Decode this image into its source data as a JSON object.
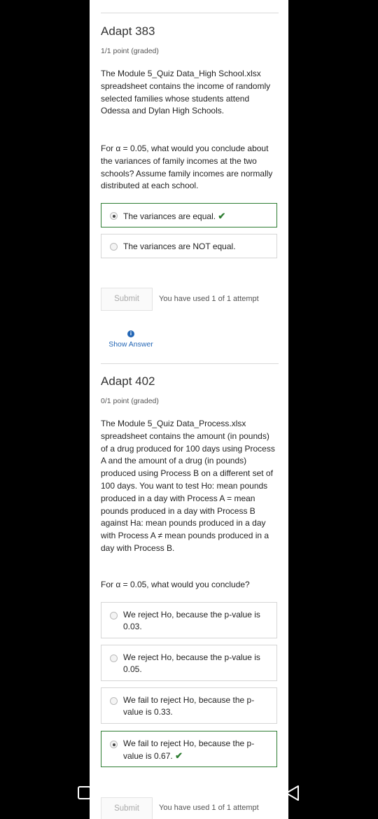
{
  "q1": {
    "title": "Adapt 383",
    "points": "1/1 point (graded)",
    "para1": "The Module 5_Quiz Data_High School.xlsx spreadsheet contains the income of randomly selected families whose students attend Odessa and Dylan High Schools.",
    "para2": "For α = 0.05, what would you conclude about the variances of family incomes at the two schools? Assume family incomes are normally distributed at each school.",
    "choices": [
      {
        "label": "The variances are equal.",
        "selected": true,
        "correct": true
      },
      {
        "label": "The variances are NOT equal.",
        "selected": false,
        "correct": false
      }
    ],
    "submit": "Submit",
    "attempts": "You have used 1 of 1 attempt",
    "show_answer": "Show Answer"
  },
  "q2": {
    "title": "Adapt 402",
    "points": "0/1 point (graded)",
    "para1": "The Module 5_Quiz Data_Process.xlsx spreadsheet contains the amount (in pounds) of a drug produced for 100 days using Process A and the amount of a drug (in pounds) produced using Process B on a different set of 100 days. You want to test Ho: mean pounds produced in a day with Process A = mean pounds produced in a day with Process B against Ha: mean pounds produced in a day with Process A ≠ mean pounds produced in a day with Process B.",
    "para2": "For α = 0.05, what would you conclude?",
    "choices": [
      {
        "label": "We reject Ho, because the p-value is 0.03.",
        "selected": false,
        "correct": false
      },
      {
        "label": "We reject Ho, because the p-value is 0.05.",
        "selected": false,
        "correct": false
      },
      {
        "label": "We fail to reject Ho, because the p-value is 0.33.",
        "selected": false,
        "correct": false
      },
      {
        "label": "We fail to reject Ho, because the p-value is 0.67.",
        "selected": true,
        "correct": true
      }
    ],
    "submit": "Submit",
    "attempts": "You have used 1 of 1 attempt"
  },
  "icons": {
    "check": "checkmark-icon",
    "info": "info-icon",
    "nav": [
      "recents-icon",
      "home-icon",
      "back-icon"
    ]
  },
  "colors": {
    "correct": "#2e7d32",
    "link": "#2366b5"
  }
}
